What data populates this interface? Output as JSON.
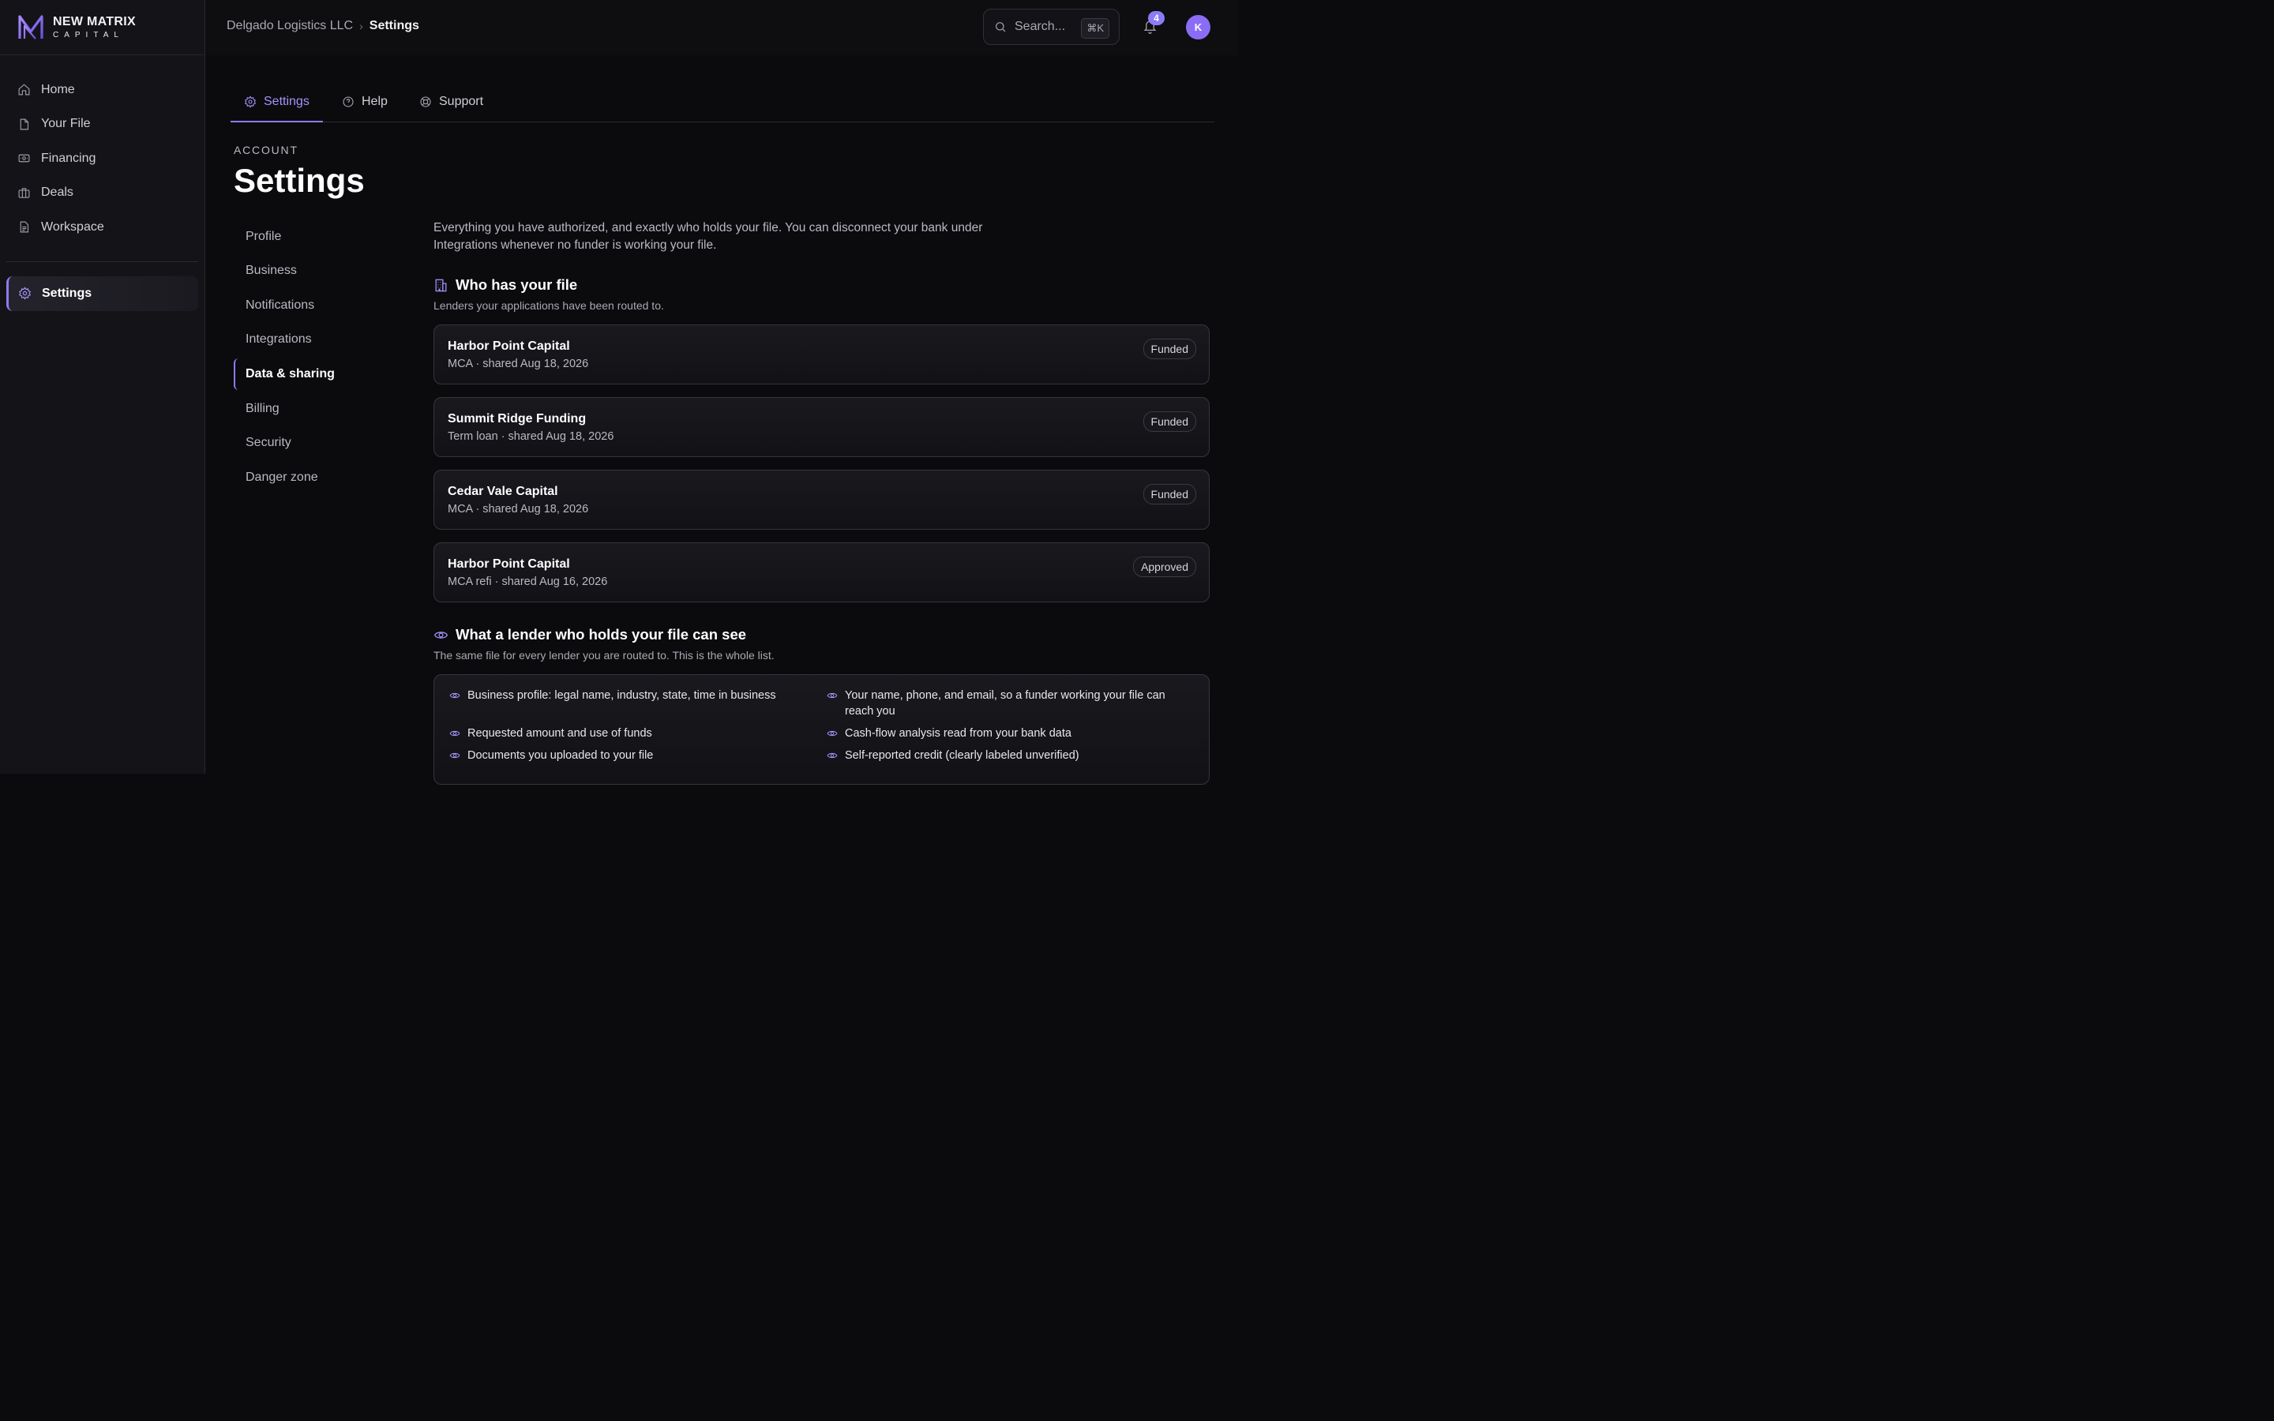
{
  "brand": {
    "name": "NEW MATRIX",
    "sub": "CAPITAL"
  },
  "sidebar": {
    "items": [
      {
        "label": "Home",
        "icon": "home-icon"
      },
      {
        "label": "Your File",
        "icon": "file-icon"
      },
      {
        "label": "Financing",
        "icon": "banknote-icon"
      },
      {
        "label": "Deals",
        "icon": "briefcase-icon"
      },
      {
        "label": "Workspace",
        "icon": "document-icon"
      }
    ],
    "active": {
      "label": "Settings",
      "icon": "gear-icon"
    }
  },
  "topbar": {
    "breadcrumb": [
      "Delgado Logistics LLC",
      "Settings"
    ],
    "search_placeholder": "Search...",
    "search_shortcut": "⌘K",
    "notification_count": "4",
    "avatar_initial": "K"
  },
  "tabs": [
    {
      "label": "Settings",
      "icon": "gear-icon",
      "active": true
    },
    {
      "label": "Help",
      "icon": "help-circle-icon",
      "active": false
    },
    {
      "label": "Support",
      "icon": "lifebuoy-icon",
      "active": false
    }
  ],
  "page": {
    "eyebrow": "ACCOUNT",
    "title": "Settings"
  },
  "subnav": [
    {
      "label": "Profile"
    },
    {
      "label": "Business"
    },
    {
      "label": "Notifications"
    },
    {
      "label": "Integrations"
    },
    {
      "label": "Data & sharing",
      "active": true
    },
    {
      "label": "Billing"
    },
    {
      "label": "Security"
    },
    {
      "label": "Danger zone"
    }
  ],
  "content": {
    "intro": "Everything you have authorized, and exactly who holds your file. You can disconnect your bank under Integrations whenever no funder is working your file.",
    "who_has": {
      "title": "Who has your file",
      "subtitle": "Lenders your applications have been routed to.",
      "lenders": [
        {
          "name": "Harbor Point Capital",
          "meta": "MCA · shared Aug 18, 2026",
          "status": "Funded"
        },
        {
          "name": "Summit Ridge Funding",
          "meta": "Term loan · shared Aug 18, 2026",
          "status": "Funded"
        },
        {
          "name": "Cedar Vale Capital",
          "meta": "MCA · shared Aug 18, 2026",
          "status": "Funded"
        },
        {
          "name": "Harbor Point Capital",
          "meta": "MCA refi · shared Aug 16, 2026",
          "status": "Approved"
        }
      ]
    },
    "visible": {
      "title": "What a lender who holds your file can see",
      "subtitle": "The same file for every lender you are routed to. This is the whole list.",
      "items": [
        "Business profile: legal name, industry, state, time in business",
        "Your name, phone, and email, so a funder working your file can reach you",
        "Requested amount and use of funds",
        "Cash-flow analysis read from your bank data",
        "Documents you uploaded to your file",
        "Self-reported credit (clearly labeled unverified)"
      ]
    }
  },
  "colors": {
    "accent": "#8b7cf6",
    "background": "#0b0b0e",
    "sidebar": "#141418"
  }
}
